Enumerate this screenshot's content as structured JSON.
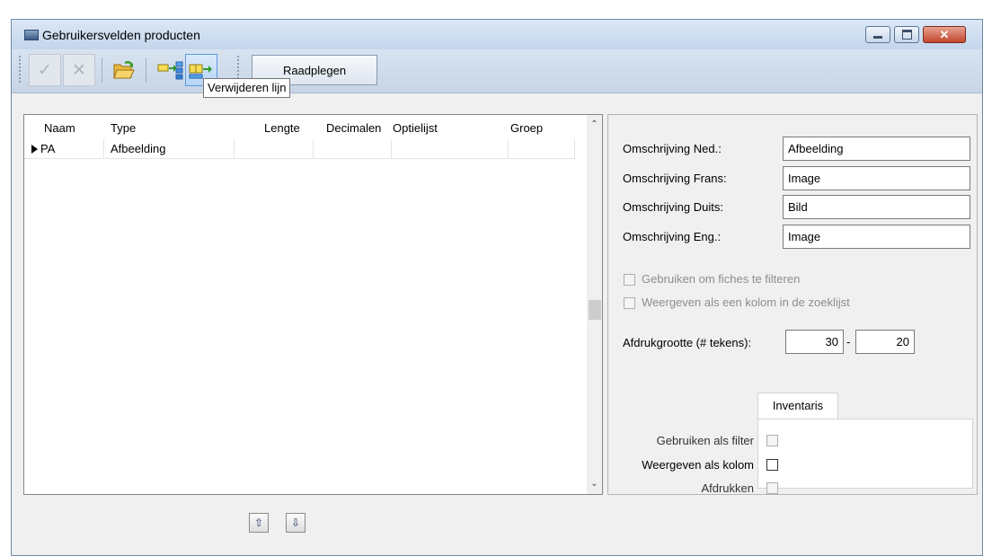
{
  "window": {
    "title": "Gebruikersvelden producten"
  },
  "toolbar": {
    "raadplegen_label": "Raadplegen",
    "tooltip": "Verwijderen lijn"
  },
  "grid": {
    "columns": [
      "Naam",
      "Type",
      "Lengte",
      "Decimalen",
      "Optielijst",
      "Groep"
    ],
    "rows": [
      {
        "naam": "PA",
        "type": "Afbeelding",
        "lengte": "",
        "decimalen": "",
        "optielijst": "",
        "groep": ""
      }
    ]
  },
  "details": {
    "omschrijving_ned_label": "Omschrijving Ned.:",
    "omschrijving_ned_value": "Afbeelding",
    "omschrijving_frans_label": "Omschrijving Frans:",
    "omschrijving_frans_value": "Image",
    "omschrijving_duits_label": "Omschrijving Duits:",
    "omschrijving_duits_value": "Bild",
    "omschrijving_eng_label": "Omschrijving Eng.:",
    "omschrijving_eng_value": "Image",
    "filter_fiches_label": "Gebruiken om fiches te filteren",
    "filter_fiches_checked": false,
    "kolom_zoeklijst_label": "Weergeven als een kolom in de zoeklijst",
    "kolom_zoeklijst_checked": false,
    "afdrukgrootte_label": "Afdrukgrootte (# tekens):",
    "afdrukgrootte_from": "30",
    "afdrukgrootte_separator": "-",
    "afdrukgrootte_to": "20",
    "tab_label": "Inventaris",
    "gebruiken_filter_label": "Gebruiken als filter",
    "weergeven_kolom_label": "Weergeven als kolom",
    "afdrukken_label": "Afdrukken"
  },
  "icons": {
    "app": "app-icon",
    "confirm": "checkmark-icon",
    "cancel": "cross-icon",
    "open": "folder-open-icon",
    "insert_line": "insert-line-icon",
    "delete_line": "delete-line-icon",
    "up": "arrow-up-icon",
    "down": "arrow-down-icon"
  }
}
